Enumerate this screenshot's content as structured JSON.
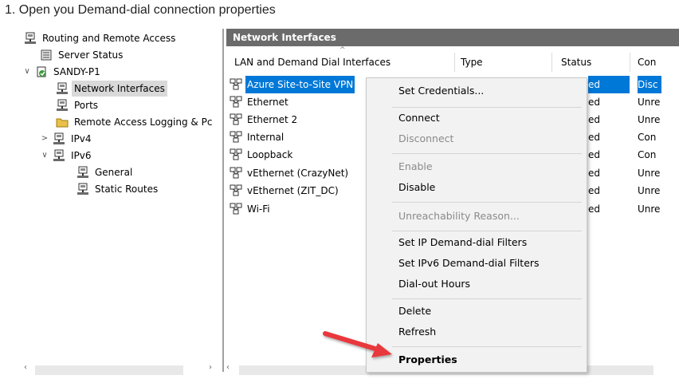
{
  "caption": "1. Open you Demand-dial connection properties",
  "tree": {
    "items": [
      {
        "label": "Routing and Remote Access",
        "expander": ""
      },
      {
        "label": "Server Status",
        "expander": ""
      },
      {
        "label": "SANDY-P1",
        "expander": "∨"
      },
      {
        "label": "Network Interfaces",
        "expander": ""
      },
      {
        "label": "Ports",
        "expander": ""
      },
      {
        "label": "Remote Access Logging & Pc",
        "expander": ""
      },
      {
        "label": "IPv4",
        "expander": ">"
      },
      {
        "label": "IPv6",
        "expander": "∨"
      },
      {
        "label": "General",
        "expander": ""
      },
      {
        "label": "Static Routes",
        "expander": ""
      }
    ]
  },
  "panel": {
    "title": "Network Interfaces",
    "columns": [
      "LAN and Demand Dial Interfaces",
      "Type",
      "Status",
      "Con"
    ],
    "rows": [
      {
        "name": "Azure Site-to-Site VPN",
        "status": "ed",
        "conn": "Disc"
      },
      {
        "name": "Ethernet",
        "status": "ed",
        "conn": "Unre"
      },
      {
        "name": "Ethernet 2",
        "status": "ed",
        "conn": "Unre"
      },
      {
        "name": "Internal",
        "status": "ed",
        "conn": "Con"
      },
      {
        "name": "Loopback",
        "status": "ed",
        "conn": "Con"
      },
      {
        "name": "vEthernet (CrazyNet)",
        "status": "ed",
        "conn": "Unre"
      },
      {
        "name": "vEthernet (ZIT_DC)",
        "status": "ed",
        "conn": "Unre"
      },
      {
        "name": "Wi-Fi",
        "status": "ed",
        "conn": "Unre"
      }
    ]
  },
  "context_menu": {
    "items": [
      "Set Credentials...",
      "Connect",
      "Disconnect",
      "Enable",
      "Disable",
      "Unreachability Reason...",
      "Set IP Demand-dial Filters",
      "Set IPv6 Demand-dial Filters",
      "Dial-out Hours",
      "Delete",
      "Refresh",
      "Properties"
    ]
  },
  "colors": {
    "selection": "#0078d7",
    "header_bar": "#6b6b6b",
    "arrow": "#e8383d"
  }
}
